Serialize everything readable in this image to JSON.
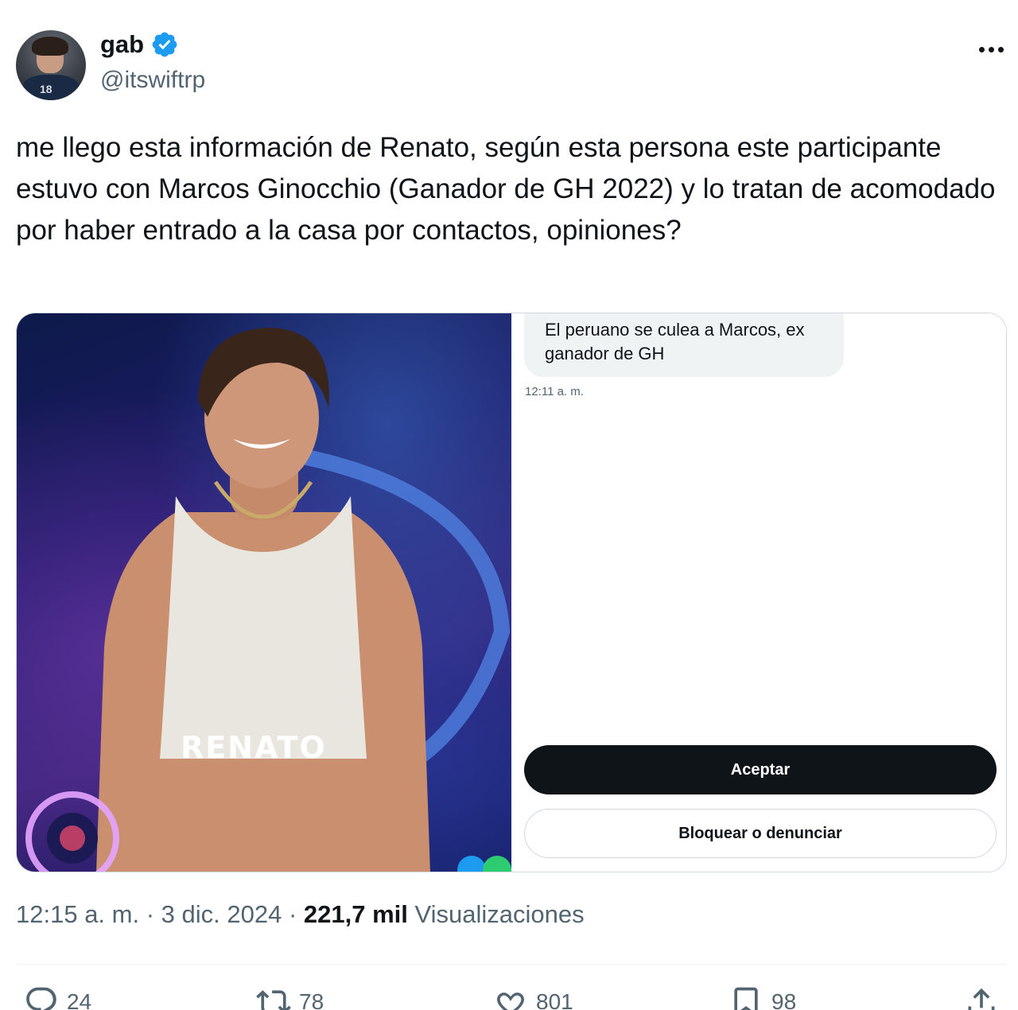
{
  "author": {
    "display_name": "gab",
    "handle": "@itswiftrp",
    "verified_badge_icon": "verified-badge-icon",
    "accent_color": "#1d9bf0"
  },
  "tweet": {
    "text": "me llego esta información de Renato, según esta persona este participante estuvo con Marcos Ginocchio (Ganador de GH 2022) y lo tratan de acomodado por haber entrado a la casa por contactos, opiniones?"
  },
  "media": {
    "photo_label": "RENATO",
    "chat": {
      "message": "El peruano se culea a Marcos, ex ganador de GH",
      "time": "12:11 a. m.",
      "accept_label": "Aceptar",
      "block_label": "Bloquear o denunciar"
    }
  },
  "meta": {
    "time": "12:15 a. m.",
    "separator": " · ",
    "date": "3 dic. 2024",
    "views_count": "221,7 mil",
    "views_label": "Visualizaciones"
  },
  "actions": {
    "replies": "24",
    "retweets": "78",
    "likes": "801",
    "bookmarks": "98"
  }
}
